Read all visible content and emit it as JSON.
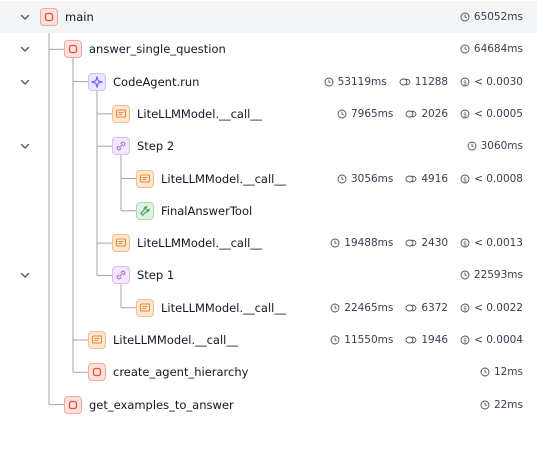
{
  "rows": [
    {
      "label": "main",
      "icon": "chain",
      "depth": 0,
      "expanded": true,
      "selected": true,
      "metrics": {
        "duration": "65052ms"
      }
    },
    {
      "label": "answer_single_question",
      "icon": "chain",
      "depth": 1,
      "expanded": true,
      "metrics": {
        "duration": "64684ms"
      }
    },
    {
      "label": "CodeAgent.run",
      "icon": "agent",
      "depth": 2,
      "expanded": true,
      "metrics": {
        "duration": "53119ms",
        "tokens": "11288",
        "cost": "< 0.0030"
      }
    },
    {
      "label": "LiteLLMModel.__call__",
      "icon": "llm",
      "depth": 3,
      "metrics": {
        "duration": "7965ms",
        "tokens": "2026",
        "cost": "< 0.0005"
      }
    },
    {
      "label": "Step 2",
      "icon": "step",
      "depth": 3,
      "expanded": true,
      "metrics": {
        "duration": "3060ms"
      }
    },
    {
      "label": "LiteLLMModel.__call__",
      "icon": "llm",
      "depth": 4,
      "metrics": {
        "duration": "3056ms",
        "tokens": "4916",
        "cost": "< 0.0008"
      }
    },
    {
      "label": "FinalAnswerTool",
      "icon": "tool",
      "depth": 4,
      "metrics": {}
    },
    {
      "label": "LiteLLMModel.__call__",
      "icon": "llm",
      "depth": 3,
      "metrics": {
        "duration": "19488ms",
        "tokens": "2430",
        "cost": "< 0.0013"
      }
    },
    {
      "label": "Step 1",
      "icon": "step",
      "depth": 3,
      "expanded": true,
      "metrics": {
        "duration": "22593ms"
      }
    },
    {
      "label": "LiteLLMModel.__call__",
      "icon": "llm",
      "depth": 4,
      "metrics": {
        "duration": "22465ms",
        "tokens": "6372",
        "cost": "< 0.0022"
      }
    },
    {
      "label": "LiteLLMModel.__call__",
      "icon": "llm",
      "depth": 2,
      "metrics": {
        "duration": "11550ms",
        "tokens": "1946",
        "cost": "< 0.0004"
      }
    },
    {
      "label": "create_agent_hierarchy",
      "icon": "chain",
      "depth": 2,
      "metrics": {
        "duration": "12ms"
      }
    },
    {
      "label": "get_examples_to_answer",
      "icon": "chain",
      "depth": 1,
      "metrics": {
        "duration": "22ms"
      }
    }
  ],
  "icon_colors": {
    "chain": "#e0533f",
    "agent": "#6b5cf6",
    "llm": "#ec8a3c",
    "step": "#b36bdb",
    "tool": "#3fa55a"
  },
  "line_color": "#9ca3af"
}
